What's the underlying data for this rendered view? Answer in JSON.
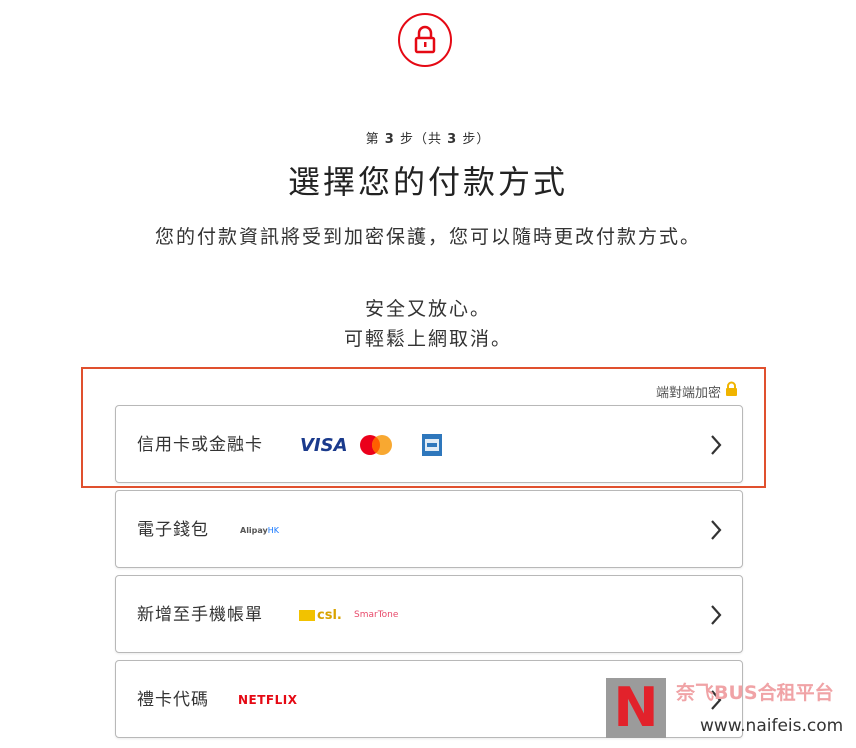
{
  "header": {
    "icon": "lock-icon",
    "step_prefix": "第",
    "step_current": "3",
    "step_mid": "步（共",
    "step_total": "3",
    "step_suffix": "步）",
    "title": "選擇您的付款方式",
    "description": "您的付款資訊將受到加密保護，您可以隨時更改付款方式。",
    "safe_line1": "安全又放心。",
    "safe_line2": "可輕鬆上網取消。"
  },
  "encryption_label": "端對端加密",
  "payment_options": [
    {
      "label": "信用卡或金融卡",
      "logos": [
        "VISA",
        "mastercard-logo",
        "amex-logo"
      ]
    },
    {
      "label": "電子錢包",
      "logos": [
        "Alipay HK"
      ]
    },
    {
      "label": "新增至手機帳單",
      "logos": [
        "csl.",
        "SmarTone"
      ]
    },
    {
      "label": "禮卡代碼",
      "logos": [
        "NETFLIX"
      ]
    }
  ],
  "logo_text": {
    "visa": "VISA",
    "alipay": "Alipay",
    "alipay_hk": "HK",
    "csl": "csl.",
    "smartone": "SmarTone",
    "netflix": "NETFLIX"
  },
  "watermark": {
    "letter": "N",
    "name": "奈飞BUS合租平台",
    "url": "www.naifeis.com"
  },
  "colors": {
    "brand_red": "#e50914",
    "highlight_border": "#e0502e",
    "lock_gold": "#f0b400"
  }
}
